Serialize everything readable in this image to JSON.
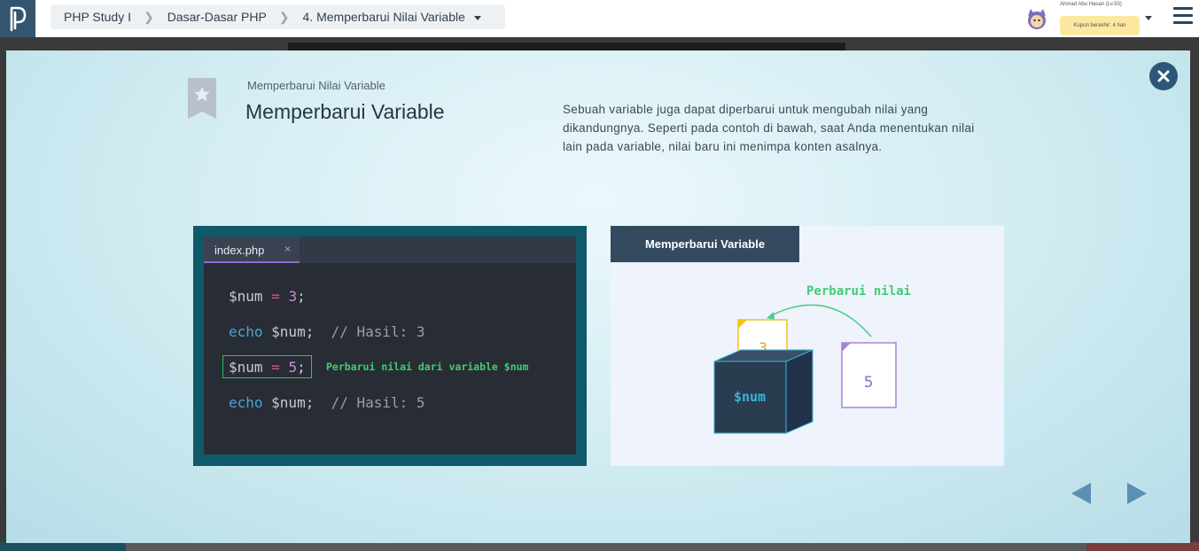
{
  "breadcrumb": {
    "items": [
      "PHP Study I",
      "Dasar-Dasar PHP",
      "4. Memperbarui Nilai Variable"
    ]
  },
  "user": {
    "name": "Ahmad Abu Hasan (Lv.50)",
    "coupon": "Kupon berakhir: 4 hari"
  },
  "lesson": {
    "subtitle": "Memperbarui Nilai Variable",
    "title": "Memperbarui Variable",
    "description": "Sebuah variable juga dapat diperbarui untuk mengubah nilai yang dikandungnya. Seperti pada contoh di bawah, saat Anda menentukan nilai lain pada variable, nilai baru ini menimpa konten asalnya."
  },
  "editor": {
    "tab_label": "index.php",
    "tab_close": "×",
    "lines": [
      {
        "var": "$num",
        "op": " = ",
        "num": "3",
        "end": ";"
      },
      {
        "kw": "echo",
        "var": " $num;",
        "cmt": "  // Hasil: 3"
      },
      {
        "var": "$num",
        "op": " = ",
        "num": "5",
        "end": ";"
      },
      {
        "kw": "echo",
        "var": " $num;",
        "cmt": "  // Hasil: 5"
      }
    ],
    "highlight_note": "Perbarui nilai dari variable $num"
  },
  "illustration": {
    "header": "Memperbarui Variable",
    "arrow_label": "Perbarui nilai",
    "box_label": "$num",
    "old_value": "3",
    "new_value": "5"
  },
  "colors": {
    "header_bg": "#33556f",
    "accent_green": "#3fce73",
    "code_bg": "#282c34",
    "panel_teal": "#0f5968"
  }
}
